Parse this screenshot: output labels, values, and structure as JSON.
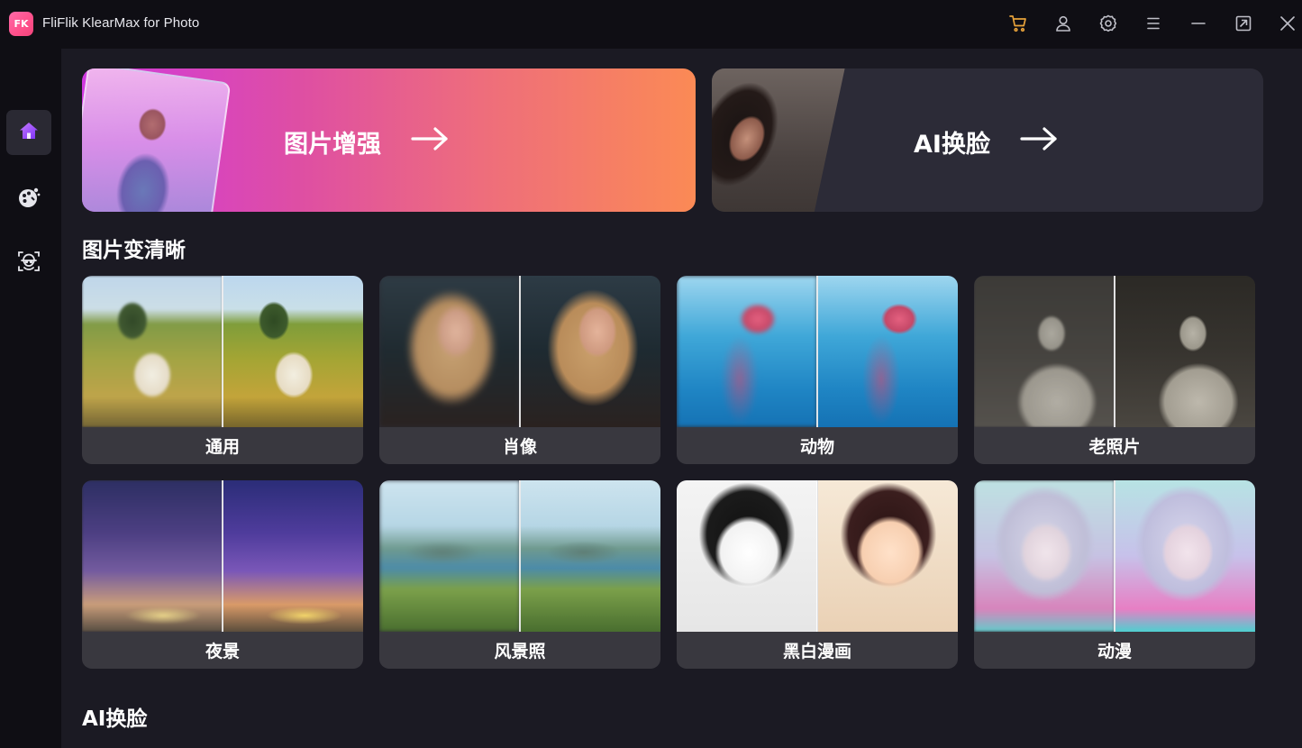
{
  "window": {
    "title": "FliFlik KlearMax for Photo",
    "logo_text": "FK",
    "icons": [
      "cart-icon",
      "user-icon",
      "settings-icon",
      "menu-icon",
      "minimize-icon",
      "maximize-icon",
      "close-icon"
    ],
    "accent_color": "#e8a23a"
  },
  "sidebar": {
    "items": [
      {
        "name": "home",
        "icon": "home-icon",
        "active": true
      },
      {
        "name": "photo-effects",
        "icon": "palette-icon",
        "active": false
      },
      {
        "name": "face-swap",
        "icon": "face-scan-icon",
        "active": false
      }
    ]
  },
  "banners": {
    "enhance": {
      "label": "图片增强",
      "arrow": "→"
    },
    "face_swap": {
      "label": "AI换脸",
      "arrow": "→"
    }
  },
  "sections": {
    "clarify": {
      "title": "图片变清晰",
      "cards": [
        {
          "label": "通用"
        },
        {
          "label": "肖像"
        },
        {
          "label": "动物"
        },
        {
          "label": "老照片"
        },
        {
          "label": "夜景"
        },
        {
          "label": "风景照"
        },
        {
          "label": "黑白漫画"
        },
        {
          "label": "动漫"
        }
      ]
    },
    "face_swap": {
      "title": "AI换脸"
    }
  }
}
